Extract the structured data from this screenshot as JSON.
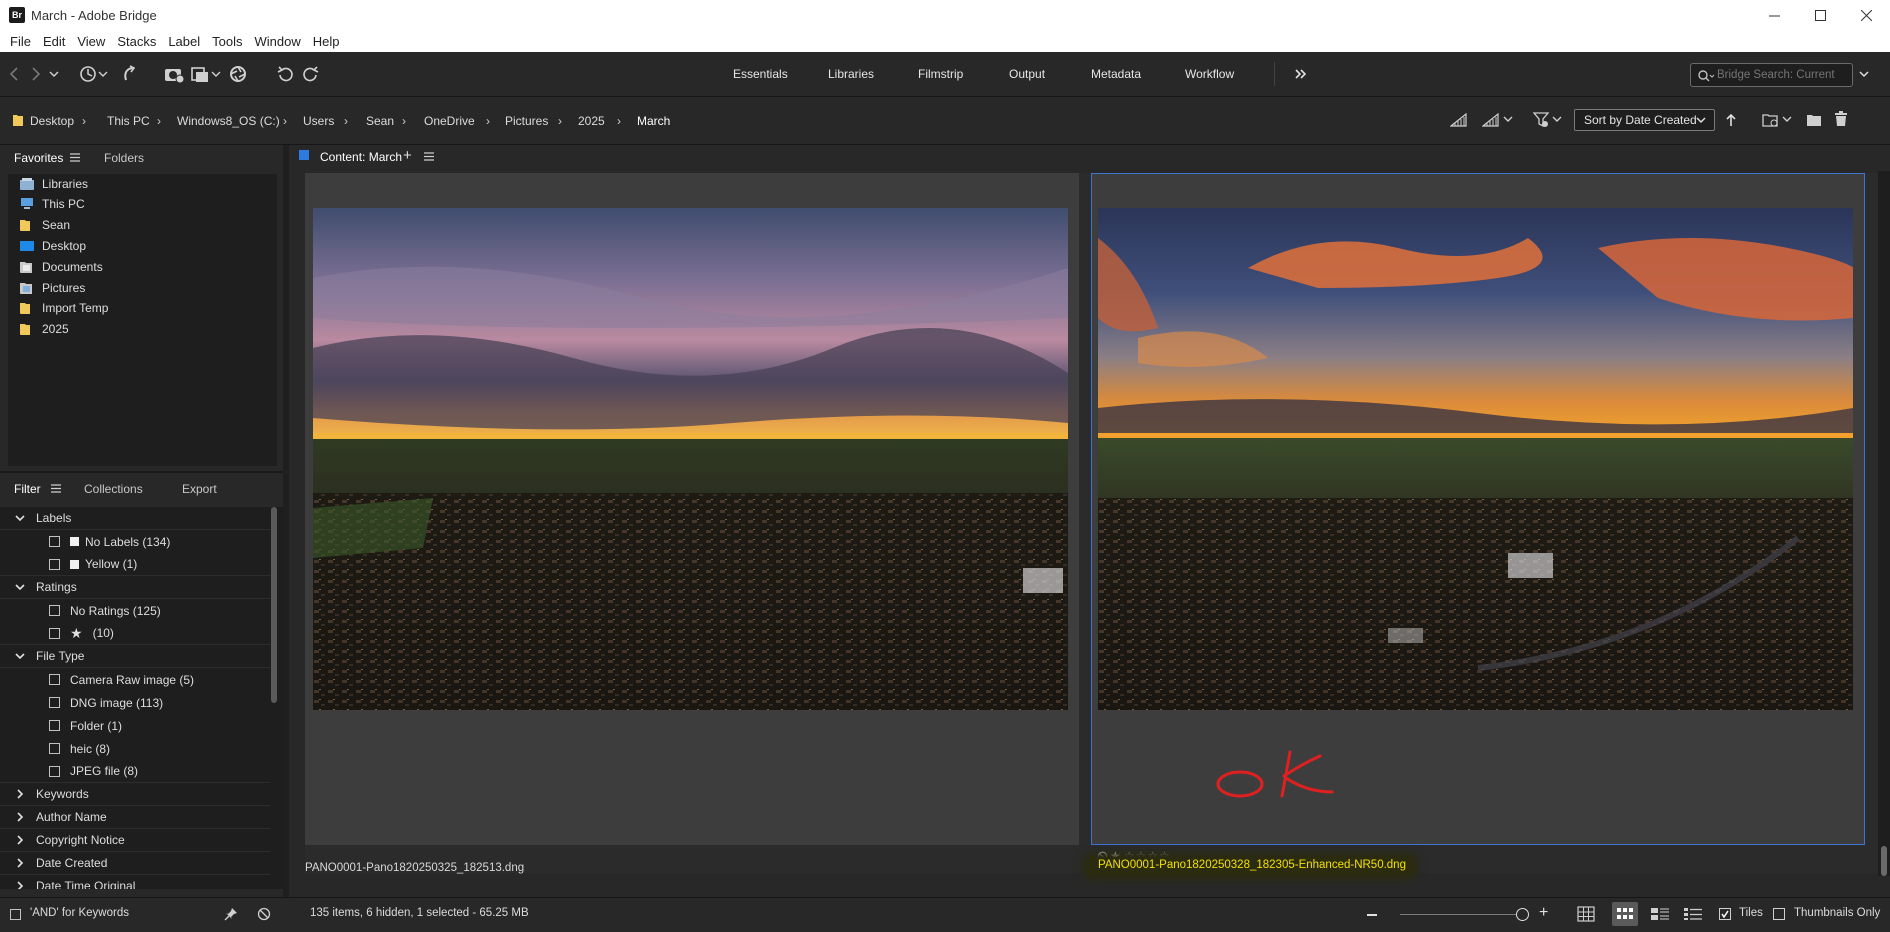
{
  "window": {
    "title": "March - Adobe Bridge",
    "logo_text": "Br"
  },
  "menu": [
    "File",
    "Edit",
    "View",
    "Stacks",
    "Label",
    "Tools",
    "Window",
    "Help"
  ],
  "workspaces": [
    "Essentials",
    "Libraries",
    "Filmstrip",
    "Output",
    "Metadata",
    "Workflow"
  ],
  "search": {
    "placeholder": "Bridge Search: Current"
  },
  "path": [
    "Desktop",
    "This PC",
    "Windows8_OS (C:)",
    "Users",
    "Sean",
    "OneDrive",
    "Pictures",
    "2025",
    "March"
  ],
  "sort": {
    "label": "Sort by Date Created"
  },
  "favorites_panel": {
    "tabs": [
      "Favorites",
      "Folders"
    ],
    "items": [
      {
        "label": "Libraries",
        "icon": "libraries-icon",
        "color": "#9bbbd8"
      },
      {
        "label": "This PC",
        "icon": "computer-icon",
        "color": "#5aa0e0"
      },
      {
        "label": "Sean",
        "icon": "folder-icon",
        "color": "#f0c95a"
      },
      {
        "label": "Desktop",
        "icon": "desktop-icon",
        "color": "#1e8ae6"
      },
      {
        "label": "Documents",
        "icon": "documents-icon",
        "color": "#c9c9c9"
      },
      {
        "label": "Pictures",
        "icon": "pictures-icon",
        "color": "#c9c9c9"
      },
      {
        "label": "Import Temp",
        "icon": "folder-icon",
        "color": "#f0c95a"
      },
      {
        "label": "2025",
        "icon": "folder-icon",
        "color": "#f0c95a"
      }
    ]
  },
  "filter_panel": {
    "tabs": [
      "Filter",
      "Collections",
      "Export"
    ],
    "sections": [
      {
        "label": "Labels",
        "expanded": true,
        "items": [
          {
            "label": "No Labels",
            "count": "(134)",
            "swatch": "#f2f2f2"
          },
          {
            "label": "Yellow",
            "count": "(1)",
            "swatch": "#f2f2f2"
          }
        ]
      },
      {
        "label": "Ratings",
        "expanded": true,
        "items": [
          {
            "label": "No Ratings",
            "count": "(125)"
          },
          {
            "label": "★",
            "count": "(10)"
          }
        ]
      },
      {
        "label": "File Type",
        "expanded": true,
        "items": [
          {
            "label": "Camera Raw image",
            "count": "(5)"
          },
          {
            "label": "DNG image",
            "count": "(113)"
          },
          {
            "label": "Folder",
            "count": "(1)"
          },
          {
            "label": "heic",
            "count": "(8)"
          },
          {
            "label": "JPEG file",
            "count": "(8)"
          }
        ]
      },
      {
        "label": "Keywords",
        "expanded": false,
        "items": []
      },
      {
        "label": "Author Name",
        "expanded": false,
        "items": []
      },
      {
        "label": "Copyright Notice",
        "expanded": false,
        "items": []
      },
      {
        "label": "Date Created",
        "expanded": false,
        "items": []
      },
      {
        "label": "Date Time Original",
        "expanded": false,
        "items": []
      }
    ],
    "and_keywords": "'AND' for Keywords"
  },
  "content": {
    "header": "Content: March",
    "thumbnails": [
      {
        "filename": "PANO0001-Pano1820250325_182513.dng",
        "selected": false
      },
      {
        "filename": "PANO0001-Pano1820250328_182305-Enhanced-NR50.dng",
        "selected": true,
        "rating": 1,
        "max_rating": 5,
        "annotation": "ok"
      }
    ]
  },
  "status": {
    "text": "135 items, 6 hidden, 1 selected - 65.25 MB",
    "tiles_label": "Tiles",
    "thumbs_only_label": "Thumbnails Only"
  },
  "colors": {
    "accent": "#3b74d1",
    "label_yellow": "#f3e000",
    "annotation_red": "#e02020"
  }
}
